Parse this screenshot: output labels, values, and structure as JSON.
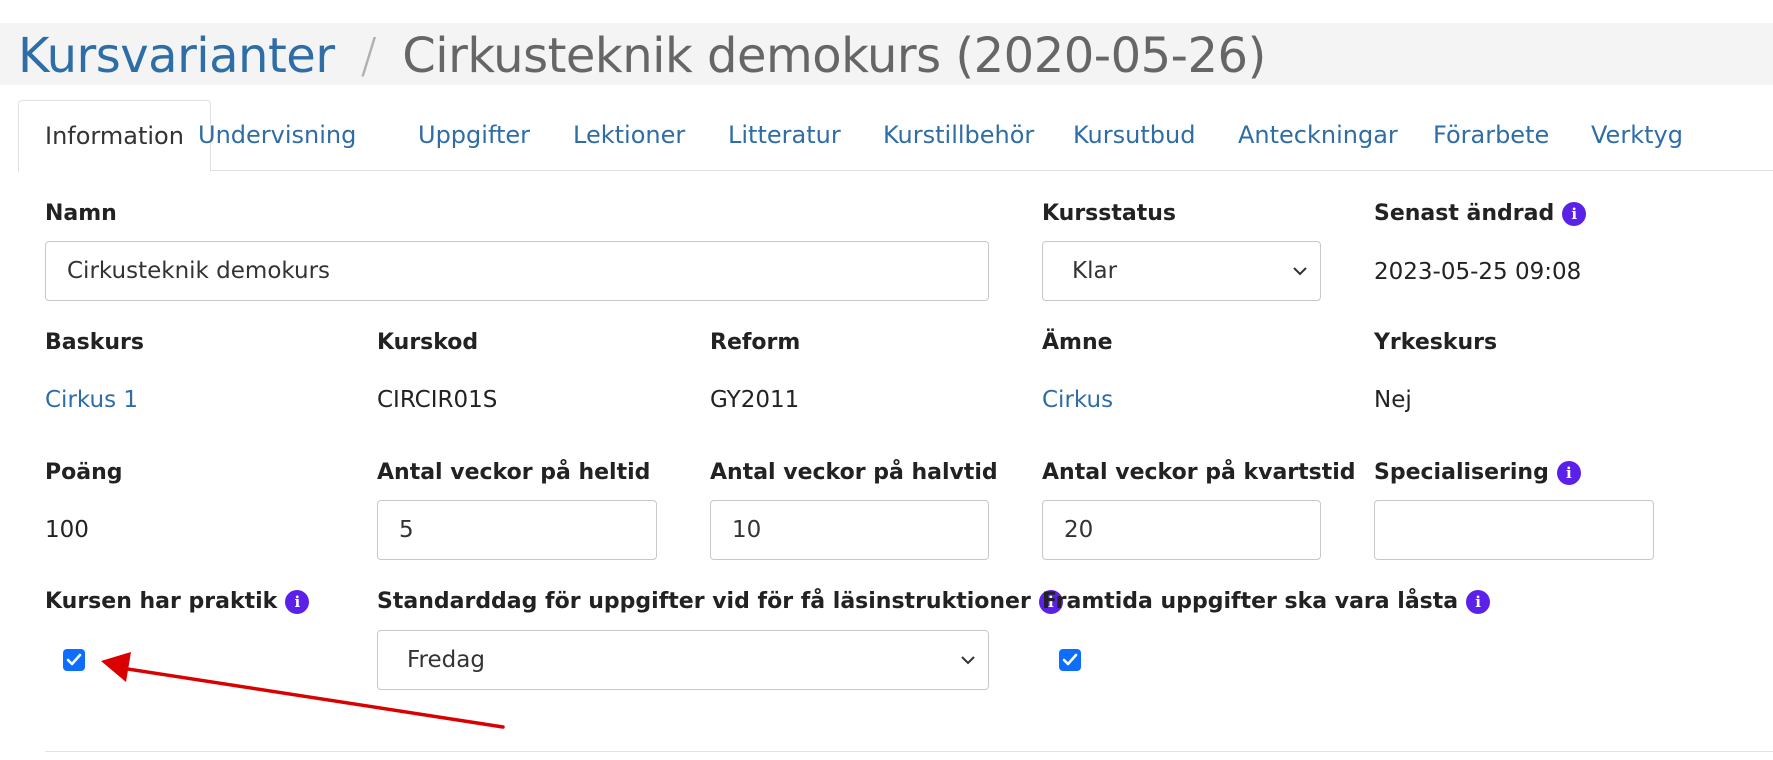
{
  "breadcrumb": {
    "parent": "Kursvarianter",
    "separator": "/",
    "current": "Cirkusteknik demokurs (2020-05-26)"
  },
  "tabs": [
    {
      "label": "Information"
    },
    {
      "label": "Undervisning"
    },
    {
      "label": "Uppgifter"
    },
    {
      "label": "Lektioner"
    },
    {
      "label": "Litteratur"
    },
    {
      "label": "Kurstillbehör"
    },
    {
      "label": "Kursutbud"
    },
    {
      "label": "Anteckningar"
    },
    {
      "label": "Förarbete"
    },
    {
      "label": "Verktyg"
    }
  ],
  "form": {
    "namn_label": "Namn",
    "namn_value": "Cirkusteknik demokurs",
    "kursstatus_label": "Kursstatus",
    "kursstatus_value": "Klar",
    "senast_label": "Senast ändrad",
    "senast_value": "2023-05-25 09:08",
    "baskurs_label": "Baskurs",
    "baskurs_value": "Cirkus 1",
    "kurskod_label": "Kurskod",
    "kurskod_value": "CIRCIR01S",
    "reform_label": "Reform",
    "reform_value": "GY2011",
    "amne_label": "Ämne",
    "amne_value": "Cirkus",
    "yrkeskurs_label": "Yrkeskurs",
    "yrkeskurs_value": "Nej",
    "poang_label": "Poäng",
    "poang_value": "100",
    "heltid_label": "Antal veckor på heltid",
    "heltid_value": "5",
    "halvtid_label": "Antal veckor på halvtid",
    "halvtid_value": "10",
    "kvartstid_label": "Antal veckor på kvartstid",
    "kvartstid_value": "20",
    "specialisering_label": "Specialisering",
    "specialisering_value": "",
    "praktik_label": "Kursen har praktik",
    "praktik_checked": true,
    "standarddag_label": "Standarddag för uppgifter vid för få läsinstruktioner",
    "standarddag_value": "Fredag",
    "framtida_label": "Framtida uppgifter ska vara låsta",
    "framtida_checked": true
  },
  "icons": {
    "info": "info-icon",
    "chevron": "chevron-down-icon",
    "check": "checkmark-icon",
    "arrow": "red-arrow-annotation"
  },
  "colors": {
    "link": "#2f6da6",
    "info_icon": "#5b21e8",
    "checkbox": "#0d6efd",
    "arrow": "#d90000"
  }
}
